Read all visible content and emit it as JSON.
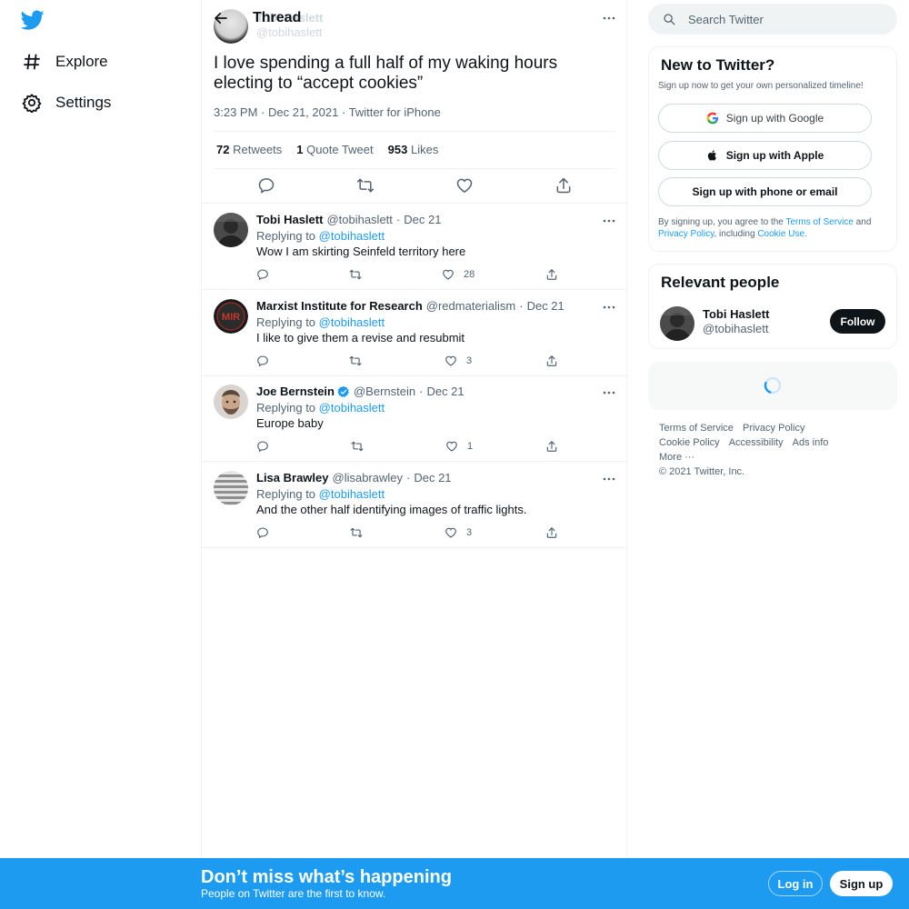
{
  "nav": {
    "items": [
      {
        "label": "Explore",
        "icon": "hashtag-icon"
      },
      {
        "label": "Settings",
        "icon": "gear-icon"
      }
    ]
  },
  "header": {
    "title": "Thread"
  },
  "tweet": {
    "name": "Tobi Haslett",
    "handle": "@tobihaslett",
    "text": "I love spending a full half of my waking hours electing to “accept cookies”",
    "time": "3:23 PM",
    "date": "Dec 21, 2021",
    "source": "Twitter for iPhone",
    "stats": {
      "retweets_count": "72",
      "retweets_label": "Retweets",
      "quotes_count": "1",
      "quotes_label": "Quote Tweet",
      "likes_count": "953",
      "likes_label": "Likes"
    }
  },
  "replies": [
    {
      "name": "Tobi Haslett",
      "handle": "@tobihaslett",
      "date": "Dec 21",
      "replying_label": "Replying to",
      "replying_to": "@tobihaslett",
      "text": "Wow I am skirting Seinfeld territory here",
      "likes": "28",
      "verified": false
    },
    {
      "name": "Marxist Institute for Research",
      "handle": "@redmaterialism",
      "date": "Dec 21",
      "replying_label": "Replying to",
      "replying_to": "@tobihaslett",
      "text": "I like to give them a revise and resubmit",
      "likes": "3",
      "verified": false
    },
    {
      "name": "Joe Bernstein",
      "handle": "@Bernstein",
      "date": "Dec 21",
      "replying_label": "Replying to",
      "replying_to": "@tobihaslett",
      "text": "Europe baby",
      "likes": "1",
      "verified": true
    },
    {
      "name": "Lisa Brawley",
      "handle": "@lisabrawley",
      "date": "Dec 21",
      "replying_label": "Replying to",
      "replying_to": "@tobihaslett",
      "text": "And the other half identifying images of traffic lights.",
      "likes": "3",
      "verified": false
    }
  ],
  "search": {
    "placeholder": "Search Twitter"
  },
  "signup_card": {
    "title": "New to Twitter?",
    "subtitle": "Sign up now to get your own personalized timeline!",
    "google": "Sign up with Google",
    "apple": "Sign up with Apple",
    "phone": "Sign up with phone or email",
    "terms_prefix": "By signing up, you agree to the",
    "terms_link": "Terms of Service",
    "and": "and",
    "privacy_link": "Privacy Policy",
    "including": ", including",
    "cookie_link": "Cookie Use."
  },
  "people_card": {
    "title": "Relevant people",
    "name": "Tobi Haslett",
    "handle": "@tobihaslett",
    "follow": "Follow"
  },
  "footer": {
    "terms": "Terms of Service",
    "privacy": "Privacy Policy",
    "cookie": "Cookie Policy",
    "accessibility": "Accessibility",
    "ads": "Ads info",
    "more": "More ···",
    "copyright": "© 2021 Twitter, Inc."
  },
  "bottom_bar": {
    "title": "Don’t miss what’s happening",
    "subtitle": "People on Twitter are the first to know.",
    "login": "Log in",
    "signup": "Sign up"
  },
  "colors": {
    "brand": "#1d9bf0",
    "text": "#0f1419",
    "muted": "#536471"
  }
}
